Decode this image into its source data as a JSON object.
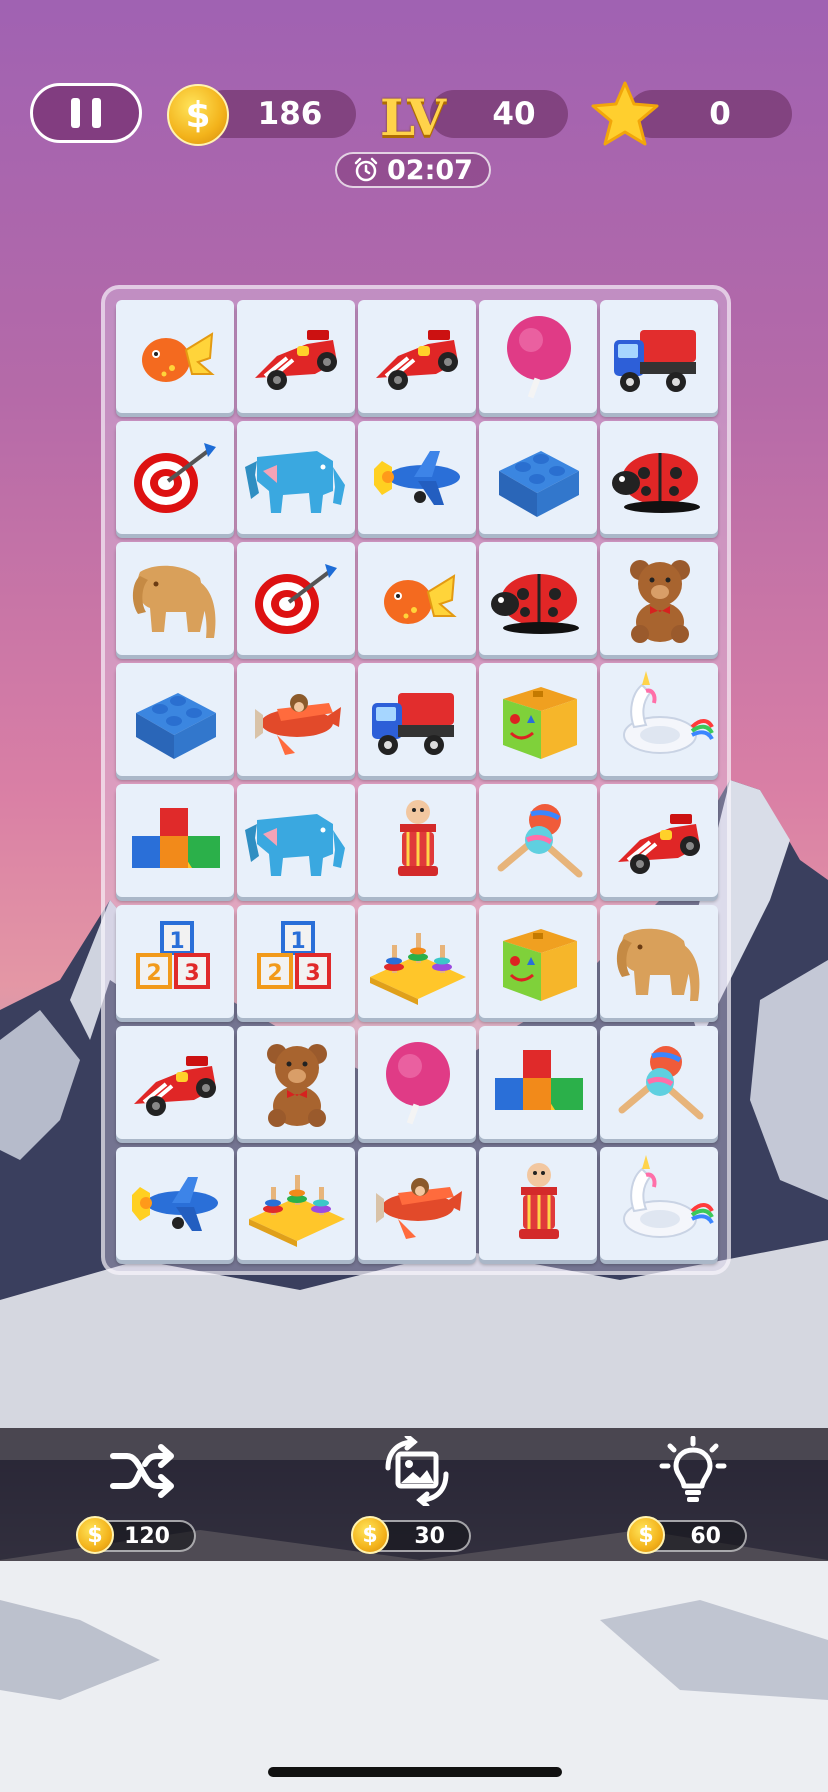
{
  "hud": {
    "coins": "186",
    "coin_symbol": "$",
    "level_label": "LV",
    "level": "40",
    "stars": "0",
    "timer": "02:07"
  },
  "board": {
    "rows": [
      [
        "fish-toy",
        "race-car",
        "race-car",
        "lollipop",
        "dump-truck"
      ],
      [
        "dartboard",
        "elephant-blue",
        "airplane-blue",
        "lego-brick",
        "ladybug"
      ],
      [
        "elephant-wood",
        "dartboard",
        "fish-toy",
        "ladybug",
        "teddy-bear"
      ],
      [
        "lego-brick",
        "airplane-red",
        "dump-truck",
        "shape-sorter",
        "unicorn-float"
      ],
      [
        "blocks",
        "elephant-blue",
        "rattle-toy",
        "maracas",
        "race-car"
      ],
      [
        "abc-blocks",
        "abc-blocks",
        "stacker",
        "shape-sorter",
        "elephant-wood"
      ],
      [
        "race-car",
        "teddy-bear",
        "lollipop",
        "blocks",
        "maracas"
      ],
      [
        "airplane-blue",
        "stacker",
        "airplane-red",
        "rattle-toy",
        "unicorn-float"
      ]
    ]
  },
  "toolbar": {
    "shuffle": {
      "icon": "shuffle-icon",
      "price": "120"
    },
    "swap": {
      "icon": "image-swap-icon",
      "price": "30"
    },
    "hint": {
      "icon": "lightbulb-icon",
      "price": "60"
    }
  },
  "colors": {
    "hud_pill": "#6a2a5e",
    "tile": "#e8f0fa",
    "coin": "#f3b31b",
    "level": "#ffd34a"
  }
}
